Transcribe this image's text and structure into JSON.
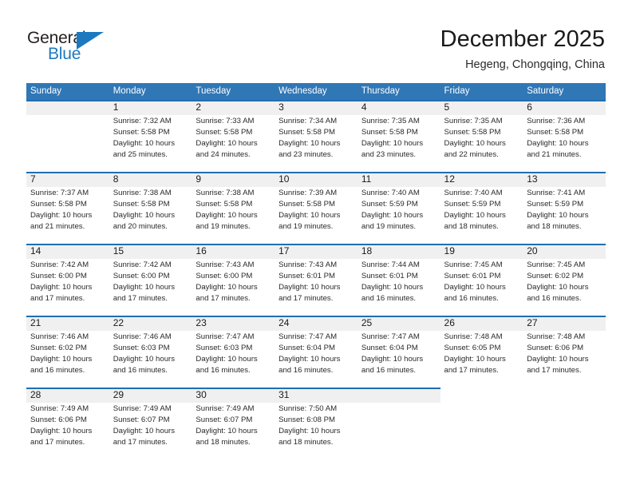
{
  "brand": {
    "name_top": "General",
    "name_bottom": "Blue",
    "accent_color": "#1c79c0"
  },
  "header": {
    "title": "December 2025",
    "subtitle": "Hegeng, Chongqing, China"
  },
  "theme": {
    "header_blue": "#3077B6",
    "rule_blue": "#1F6FB2",
    "date_band_gray": "#f0f0f0",
    "page_background": "#ffffff"
  },
  "weekdays": [
    "Sunday",
    "Monday",
    "Tuesday",
    "Wednesday",
    "Thursday",
    "Friday",
    "Saturday"
  ],
  "labels": {
    "sunrise_prefix": "Sunrise:",
    "sunset_prefix": "Sunset:",
    "daylight_prefix": "Daylight:"
  },
  "weeks": [
    {
      "band_width_cols": 7,
      "days": [
        {
          "date": "",
          "line1": "",
          "line2": "",
          "line3": "",
          "line4": "",
          "empty": true
        },
        {
          "date": "1",
          "line1": "Sunrise: 7:32 AM",
          "line2": "Sunset: 5:58 PM",
          "line3": "Daylight: 10 hours",
          "line4": "and 25 minutes.",
          "empty": false
        },
        {
          "date": "2",
          "line1": "Sunrise: 7:33 AM",
          "line2": "Sunset: 5:58 PM",
          "line3": "Daylight: 10 hours",
          "line4": "and 24 minutes.",
          "empty": false
        },
        {
          "date": "3",
          "line1": "Sunrise: 7:34 AM",
          "line2": "Sunset: 5:58 PM",
          "line3": "Daylight: 10 hours",
          "line4": "and 23 minutes.",
          "empty": false
        },
        {
          "date": "4",
          "line1": "Sunrise: 7:35 AM",
          "line2": "Sunset: 5:58 PM",
          "line3": "Daylight: 10 hours",
          "line4": "and 23 minutes.",
          "empty": false
        },
        {
          "date": "5",
          "line1": "Sunrise: 7:35 AM",
          "line2": "Sunset: 5:58 PM",
          "line3": "Daylight: 10 hours",
          "line4": "and 22 minutes.",
          "empty": false
        },
        {
          "date": "6",
          "line1": "Sunrise: 7:36 AM",
          "line2": "Sunset: 5:58 PM",
          "line3": "Daylight: 10 hours",
          "line4": "and 21 minutes.",
          "empty": false
        }
      ]
    },
    {
      "band_width_cols": 7,
      "days": [
        {
          "date": "7",
          "line1": "Sunrise: 7:37 AM",
          "line2": "Sunset: 5:58 PM",
          "line3": "Daylight: 10 hours",
          "line4": "and 21 minutes.",
          "empty": false
        },
        {
          "date": "8",
          "line1": "Sunrise: 7:38 AM",
          "line2": "Sunset: 5:58 PM",
          "line3": "Daylight: 10 hours",
          "line4": "and 20 minutes.",
          "empty": false
        },
        {
          "date": "9",
          "line1": "Sunrise: 7:38 AM",
          "line2": "Sunset: 5:58 PM",
          "line3": "Daylight: 10 hours",
          "line4": "and 19 minutes.",
          "empty": false
        },
        {
          "date": "10",
          "line1": "Sunrise: 7:39 AM",
          "line2": "Sunset: 5:58 PM",
          "line3": "Daylight: 10 hours",
          "line4": "and 19 minutes.",
          "empty": false
        },
        {
          "date": "11",
          "line1": "Sunrise: 7:40 AM",
          "line2": "Sunset: 5:59 PM",
          "line3": "Daylight: 10 hours",
          "line4": "and 19 minutes.",
          "empty": false
        },
        {
          "date": "12",
          "line1": "Sunrise: 7:40 AM",
          "line2": "Sunset: 5:59 PM",
          "line3": "Daylight: 10 hours",
          "line4": "and 18 minutes.",
          "empty": false
        },
        {
          "date": "13",
          "line1": "Sunrise: 7:41 AM",
          "line2": "Sunset: 5:59 PM",
          "line3": "Daylight: 10 hours",
          "line4": "and 18 minutes.",
          "empty": false
        }
      ]
    },
    {
      "band_width_cols": 7,
      "days": [
        {
          "date": "14",
          "line1": "Sunrise: 7:42 AM",
          "line2": "Sunset: 6:00 PM",
          "line3": "Daylight: 10 hours",
          "line4": "and 17 minutes.",
          "empty": false
        },
        {
          "date": "15",
          "line1": "Sunrise: 7:42 AM",
          "line2": "Sunset: 6:00 PM",
          "line3": "Daylight: 10 hours",
          "line4": "and 17 minutes.",
          "empty": false
        },
        {
          "date": "16",
          "line1": "Sunrise: 7:43 AM",
          "line2": "Sunset: 6:00 PM",
          "line3": "Daylight: 10 hours",
          "line4": "and 17 minutes.",
          "empty": false
        },
        {
          "date": "17",
          "line1": "Sunrise: 7:43 AM",
          "line2": "Sunset: 6:01 PM",
          "line3": "Daylight: 10 hours",
          "line4": "and 17 minutes.",
          "empty": false
        },
        {
          "date": "18",
          "line1": "Sunrise: 7:44 AM",
          "line2": "Sunset: 6:01 PM",
          "line3": "Daylight: 10 hours",
          "line4": "and 16 minutes.",
          "empty": false
        },
        {
          "date": "19",
          "line1": "Sunrise: 7:45 AM",
          "line2": "Sunset: 6:01 PM",
          "line3": "Daylight: 10 hours",
          "line4": "and 16 minutes.",
          "empty": false
        },
        {
          "date": "20",
          "line1": "Sunrise: 7:45 AM",
          "line2": "Sunset: 6:02 PM",
          "line3": "Daylight: 10 hours",
          "line4": "and 16 minutes.",
          "empty": false
        }
      ]
    },
    {
      "band_width_cols": 7,
      "days": [
        {
          "date": "21",
          "line1": "Sunrise: 7:46 AM",
          "line2": "Sunset: 6:02 PM",
          "line3": "Daylight: 10 hours",
          "line4": "and 16 minutes.",
          "empty": false
        },
        {
          "date": "22",
          "line1": "Sunrise: 7:46 AM",
          "line2": "Sunset: 6:03 PM",
          "line3": "Daylight: 10 hours",
          "line4": "and 16 minutes.",
          "empty": false
        },
        {
          "date": "23",
          "line1": "Sunrise: 7:47 AM",
          "line2": "Sunset: 6:03 PM",
          "line3": "Daylight: 10 hours",
          "line4": "and 16 minutes.",
          "empty": false
        },
        {
          "date": "24",
          "line1": "Sunrise: 7:47 AM",
          "line2": "Sunset: 6:04 PM",
          "line3": "Daylight: 10 hours",
          "line4": "and 16 minutes.",
          "empty": false
        },
        {
          "date": "25",
          "line1": "Sunrise: 7:47 AM",
          "line2": "Sunset: 6:04 PM",
          "line3": "Daylight: 10 hours",
          "line4": "and 16 minutes.",
          "empty": false
        },
        {
          "date": "26",
          "line1": "Sunrise: 7:48 AM",
          "line2": "Sunset: 6:05 PM",
          "line3": "Daylight: 10 hours",
          "line4": "and 17 minutes.",
          "empty": false
        },
        {
          "date": "27",
          "line1": "Sunrise: 7:48 AM",
          "line2": "Sunset: 6:06 PM",
          "line3": "Daylight: 10 hours",
          "line4": "and 17 minutes.",
          "empty": false
        }
      ]
    },
    {
      "band_width_cols": 5,
      "days": [
        {
          "date": "28",
          "line1": "Sunrise: 7:49 AM",
          "line2": "Sunset: 6:06 PM",
          "line3": "Daylight: 10 hours",
          "line4": "and 17 minutes.",
          "empty": false
        },
        {
          "date": "29",
          "line1": "Sunrise: 7:49 AM",
          "line2": "Sunset: 6:07 PM",
          "line3": "Daylight: 10 hours",
          "line4": "and 17 minutes.",
          "empty": false
        },
        {
          "date": "30",
          "line1": "Sunrise: 7:49 AM",
          "line2": "Sunset: 6:07 PM",
          "line3": "Daylight: 10 hours",
          "line4": "and 18 minutes.",
          "empty": false
        },
        {
          "date": "31",
          "line1": "Sunrise: 7:50 AM",
          "line2": "Sunset: 6:08 PM",
          "line3": "Daylight: 10 hours",
          "line4": "and 18 minutes.",
          "empty": false
        },
        {
          "date": "",
          "line1": "",
          "line2": "",
          "line3": "",
          "line4": "",
          "empty": true
        },
        {
          "date": "",
          "line1": "",
          "line2": "",
          "line3": "",
          "line4": "",
          "empty": true
        },
        {
          "date": "",
          "line1": "",
          "line2": "",
          "line3": "",
          "line4": "",
          "empty": true
        }
      ]
    }
  ]
}
